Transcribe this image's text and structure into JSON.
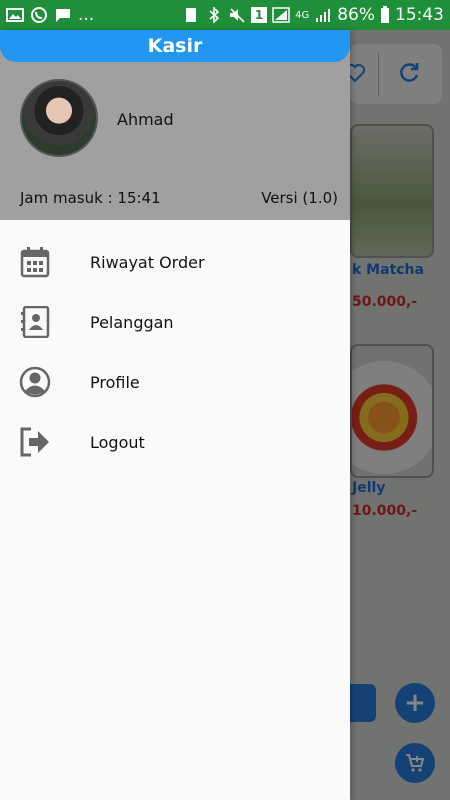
{
  "status_bar": {
    "battery_percent": "86%",
    "time": "15:43",
    "network": "4G",
    "notification_badge": "1",
    "overflow": "..."
  },
  "drawer": {
    "app_title": "Kasir",
    "user_name": "Ahmad",
    "checkin_label": "Jam masuk : 15:41",
    "version_label": "Versi (1.0)",
    "menu": [
      {
        "label": "Riwayat Order",
        "icon": "calendar-icon"
      },
      {
        "label": "Pelanggan",
        "icon": "contacts-icon"
      },
      {
        "label": "Profile",
        "icon": "account-circle-icon"
      },
      {
        "label": "Logout",
        "icon": "logout-icon"
      }
    ]
  },
  "background_screen": {
    "products": [
      {
        "name": "k Matcha",
        "price": "50.000,-"
      },
      {
        "name": "Jelly",
        "price": "10.000,-"
      }
    ]
  },
  "colors": {
    "status_bar": "#1f8f3a",
    "app_bar": "#2196f3",
    "drawer_header": "#a0a0a0",
    "drawer_body": "#fafafa",
    "icon_gray": "#666666",
    "product_name": "#1e6fd8",
    "product_price": "#d42b2b"
  }
}
